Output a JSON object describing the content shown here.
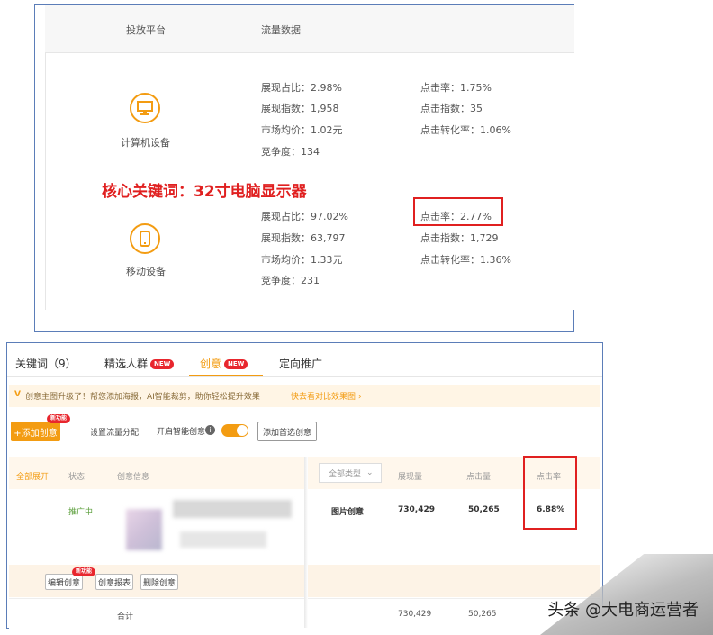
{
  "top": {
    "header": {
      "platform": "投放平台",
      "traffic": "流量数据"
    },
    "keyword_title": "核心关键词：32寸电脑显示器",
    "devices": [
      {
        "label": "计算机设备",
        "icon": "computer-icon",
        "metrics_left": [
          "展现占比：2.98%",
          "展现指数：1,958",
          "市场均价：1.02元",
          "竞争度：134"
        ],
        "metrics_right": [
          "点击率：1.75%",
          "点击指数：35",
          "点击转化率：1.06%"
        ]
      },
      {
        "label": "移动设备",
        "icon": "mobile-icon",
        "metrics_left": [
          "展现占比：97.02%",
          "展现指数：63,797",
          "市场均价：1.33元",
          "竞争度：231"
        ],
        "metrics_right": [
          "点击率：2.77%",
          "点击指数：1,729",
          "点击转化率：1.36%"
        ]
      }
    ]
  },
  "bottom": {
    "tabs": [
      {
        "label": "关键词（9）"
      },
      {
        "label": "精选人群",
        "badge": "NEW"
      },
      {
        "label": "创意",
        "badge": "NEW"
      },
      {
        "label": "定向推广"
      }
    ],
    "notice": {
      "icon_text": "V",
      "text": "创意主图升级了！帮您添加海报，AI智能裁剪，助你轻松提升效果",
      "link": "快去看对比效果图 ›"
    },
    "toolbar": {
      "add_label": "+添加创意",
      "add_new_tag": "新功能",
      "set_flow_label": "设置流量分配",
      "smart_creative_label": "开启智能创意",
      "info_icon": "i",
      "preferred_label": "添加首选创意"
    },
    "table": {
      "headers": [
        "全部展开",
        "状态",
        "创意信息",
        "全部类型",
        "展现量",
        "点击量",
        "点击率"
      ],
      "row": {
        "status": "推广中",
        "type": "图片创意",
        "impressions": "730,429",
        "clicks": "50,265",
        "ctr": "6.88%"
      },
      "ops": [
        "编辑创意",
        "创意报表",
        "删除创意"
      ],
      "ops_new_tag": "新功能",
      "total": {
        "label": "合计",
        "impressions": "730,429",
        "clicks": "50,265"
      }
    }
  },
  "watermark": "头条 @大电商运营者",
  "colors": {
    "accent": "#f39c12",
    "red": "#e02020",
    "new_badge": "#e8262d",
    "frame": "#5b7db8"
  }
}
